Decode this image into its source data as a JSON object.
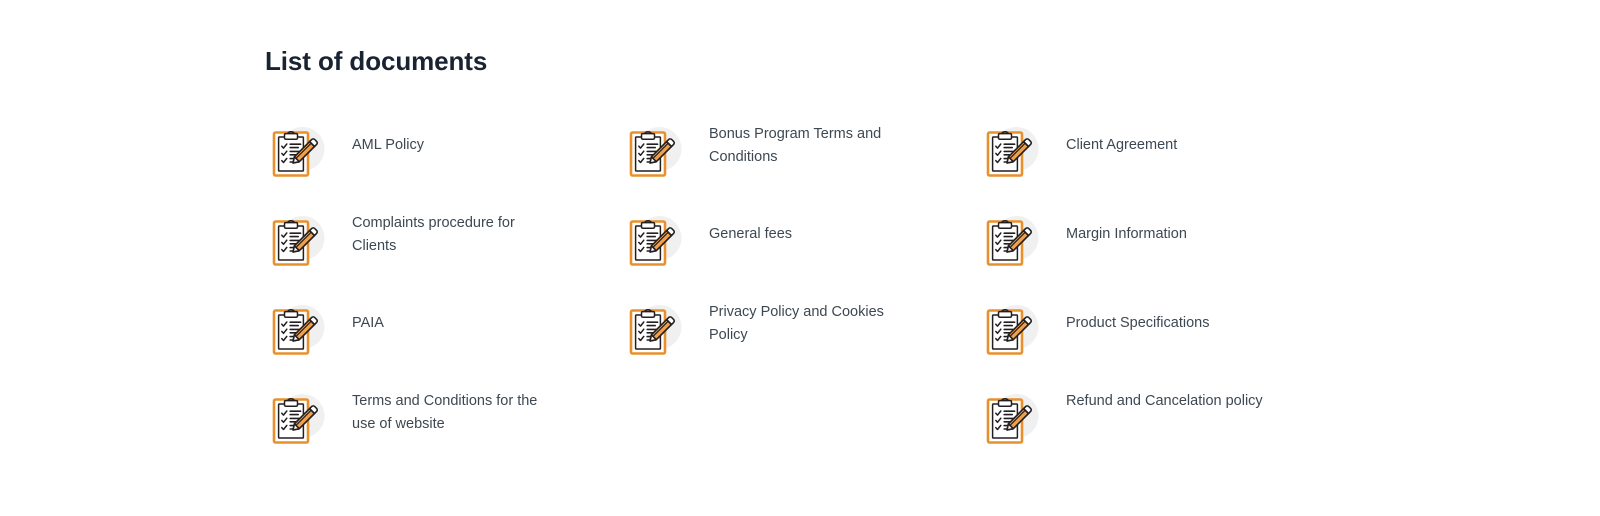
{
  "page": {
    "title": "List of documents",
    "background_color": "#ffffff",
    "title_color": "#1a2332",
    "label_color": "#3d4852",
    "accent_color": "#e8902b",
    "outline_color": "#231f20",
    "icon_circle_color": "#f0f0f0"
  },
  "documents": [
    {
      "label": "AML Policy",
      "icon": "clipboard-checklist-pencil-icon",
      "lines": 1
    },
    {
      "label": "Bonus Program Terms and Conditions",
      "icon": "clipboard-checklist-pencil-icon",
      "lines": 2
    },
    {
      "label": "Client Agreement",
      "icon": "clipboard-checklist-pencil-icon",
      "lines": 1
    },
    {
      "label": "Complaints procedure for Clients",
      "icon": "clipboard-checklist-pencil-icon",
      "lines": 2
    },
    {
      "label": "General fees",
      "icon": "clipboard-checklist-pencil-icon",
      "lines": 1
    },
    {
      "label": "Margin Information",
      "icon": "clipboard-checklist-pencil-icon",
      "lines": 1
    },
    {
      "label": "PAIA",
      "icon": "clipboard-checklist-pencil-icon",
      "lines": 1
    },
    {
      "label": "Privacy Policy and Cookies Policy",
      "icon": "clipboard-checklist-pencil-icon",
      "lines": 2
    },
    {
      "label": "Product Specifications",
      "icon": "clipboard-checklist-pencil-icon",
      "lines": 1
    },
    {
      "label": "Terms and Conditions for the use of website",
      "icon": "clipboard-checklist-pencil-icon",
      "lines": 2
    },
    {
      "label": "",
      "icon": "",
      "lines": 0
    },
    {
      "label": "Refund and Cancelation policy",
      "icon": "clipboard-checklist-pencil-icon",
      "lines": 2
    }
  ]
}
